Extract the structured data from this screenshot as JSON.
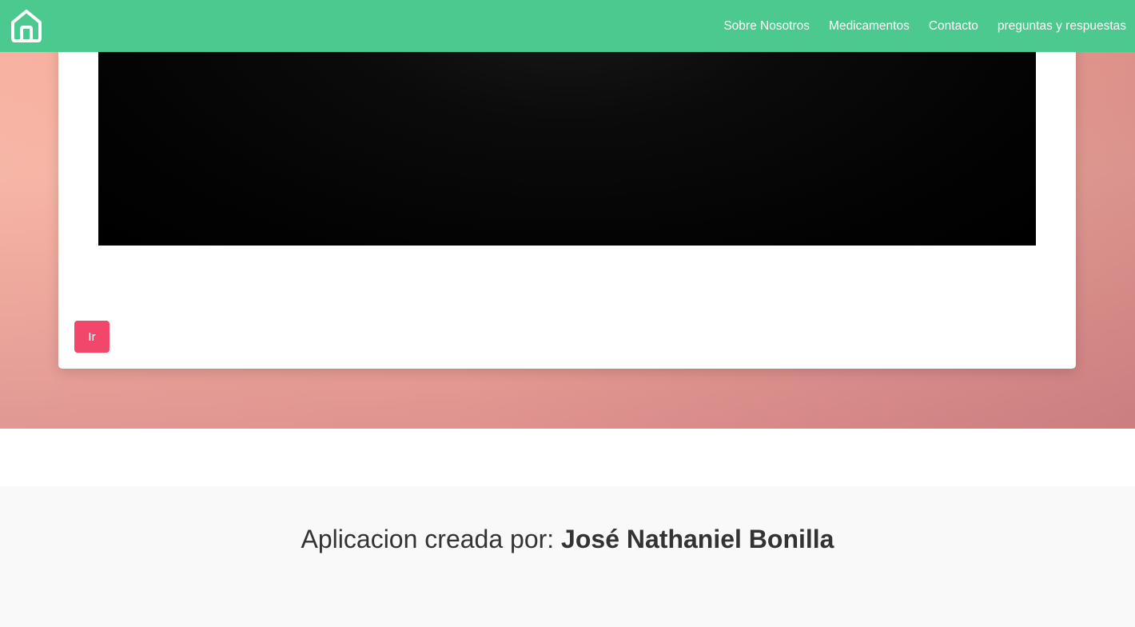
{
  "colors": {
    "navbar": "#4bc98e",
    "button": "#f0476b",
    "footer_bg": "#f9f9f9",
    "text": "#333333"
  },
  "navbar": {
    "home_icon": "home-icon",
    "links": [
      {
        "label": "Sobre Nosotros"
      },
      {
        "label": "Medicamentos"
      },
      {
        "label": "Contacto"
      },
      {
        "label": "preguntas y respuestas"
      }
    ]
  },
  "card": {
    "button_label": "Ir"
  },
  "footer": {
    "prefix": "Aplicacion creada por:",
    "author": "José Nathaniel Bonilla"
  }
}
